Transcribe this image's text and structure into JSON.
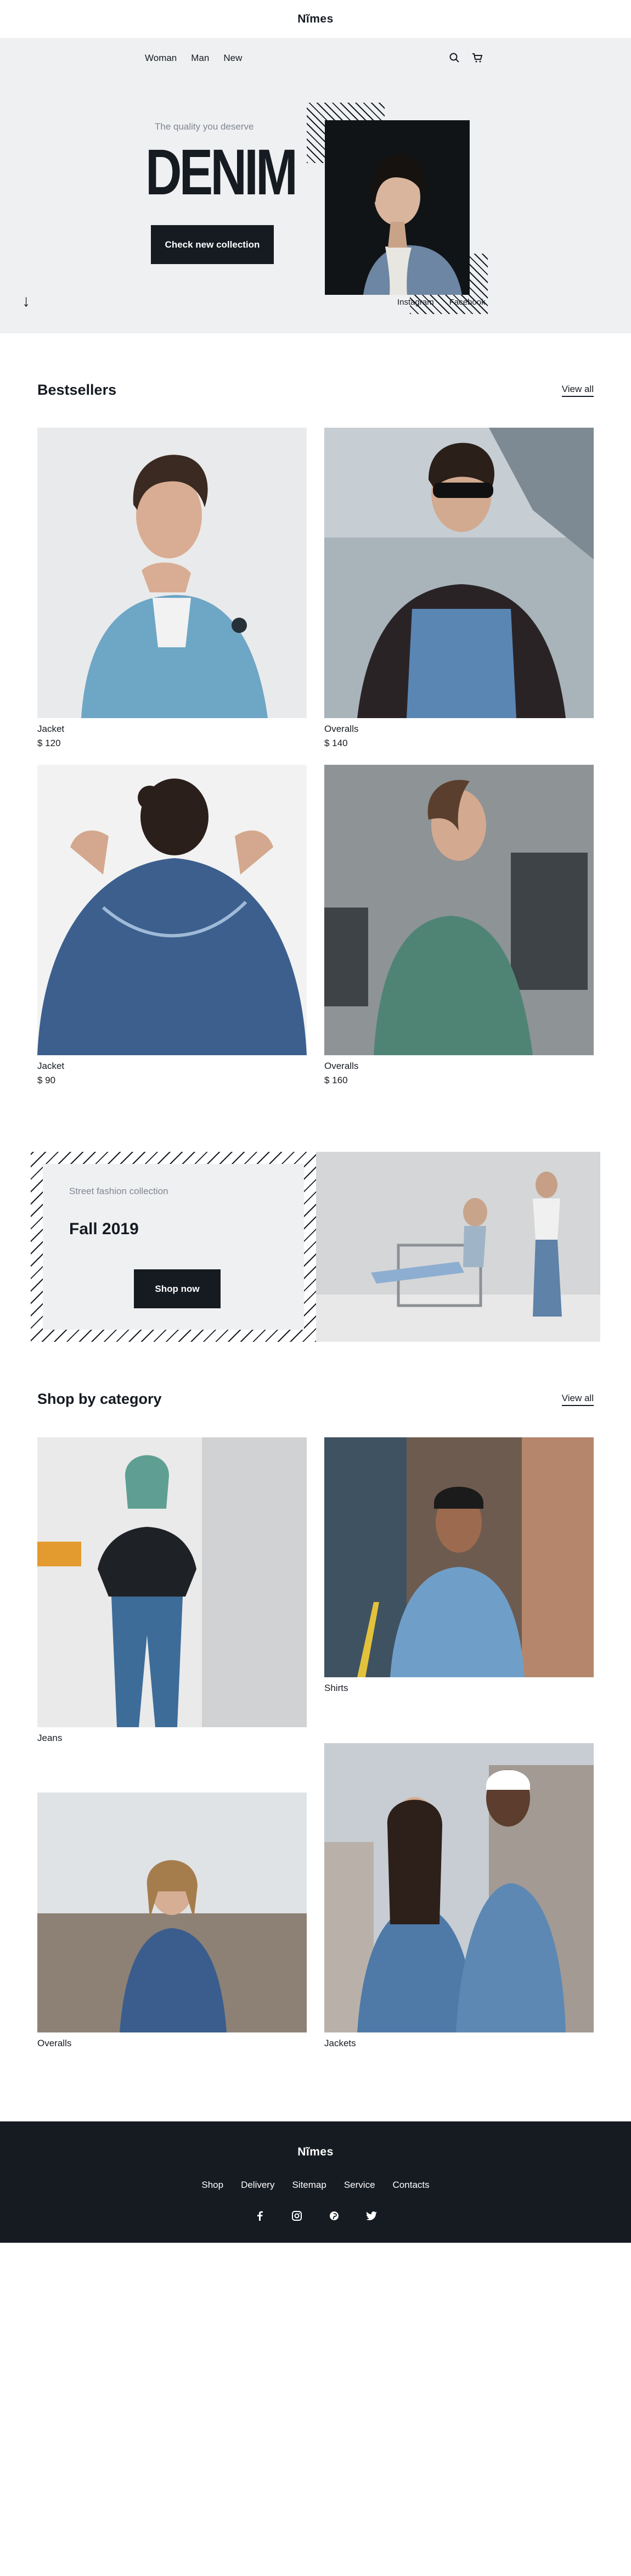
{
  "brand": "Nĩmes",
  "hero": {
    "nav": [
      "Woman",
      "Man",
      "New"
    ],
    "tagline": "The quality you deserve",
    "headline": "DENIM",
    "cta": "Check new collection",
    "socials": [
      "Instagram",
      "Facebook"
    ]
  },
  "bestsellers": {
    "title": "Bestsellers",
    "view_all": "View all",
    "products": [
      {
        "name": "Jacket",
        "price": "$ 120"
      },
      {
        "name": "Overalls",
        "price": "$ 140"
      },
      {
        "name": "Jacket",
        "price": "$ 90"
      },
      {
        "name": "Overalls",
        "price": "$ 160"
      }
    ]
  },
  "promo": {
    "subtitle": "Street fashion collection",
    "title": "Fall 2019",
    "cta": "Shop now"
  },
  "categories": {
    "title": "Shop by category",
    "view_all": "View all",
    "items": [
      "Jeans",
      "Shirts",
      "Overalls",
      "Jackets"
    ]
  },
  "footer": {
    "brand": "Nĩmes",
    "links": [
      "Shop",
      "Delivery",
      "Sitemap",
      "Service",
      "Contacts"
    ],
    "socials": [
      "facebook-icon",
      "instagram-icon",
      "pinterest-icon",
      "twitter-icon"
    ]
  },
  "colors": {
    "dark": "#161b22",
    "light_bg": "#eff0f2",
    "muted": "#808791"
  }
}
